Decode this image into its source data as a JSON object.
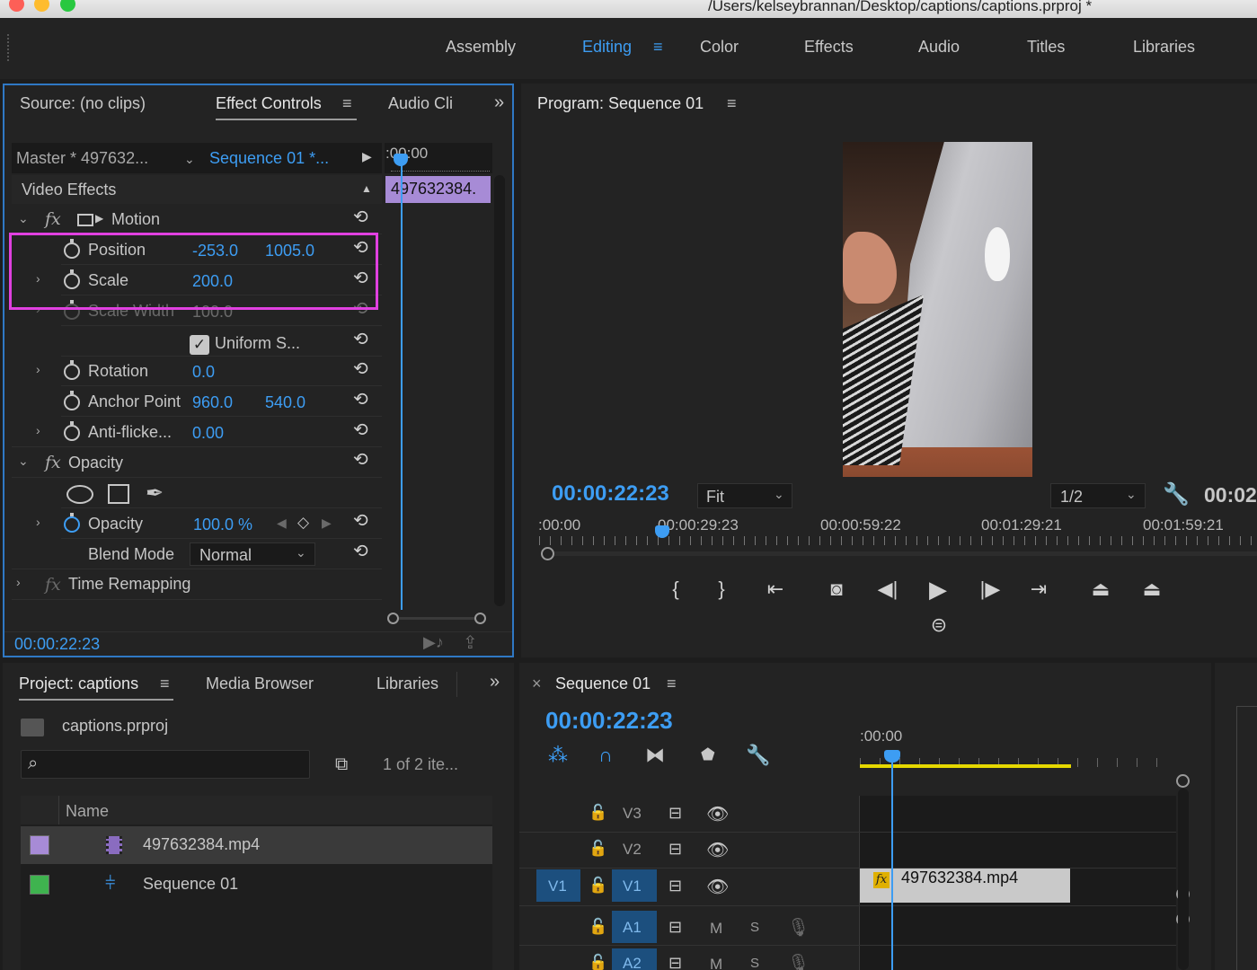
{
  "window": {
    "title": "/Users/kelseybrannan/Desktop/captions/captions.prproj *"
  },
  "workspaces": [
    "Assembly",
    "Editing",
    "Color",
    "Effects",
    "Audio",
    "Titles",
    "Libraries"
  ],
  "workspace_menu_icon": "≡",
  "source_panel": {
    "tabs": [
      "Source: (no clips)",
      "Effect Controls",
      "Audio Cli"
    ],
    "overflow": "»",
    "master_label": "Master * 497632...",
    "sequence_label": "Sequence 01 *...",
    "ruler_time": ":00:00",
    "clip_label": "497632384.",
    "section": "Video Effects",
    "motion": "Motion",
    "position": {
      "label": "Position",
      "x": "-253.0",
      "y": "1005.0"
    },
    "scale": {
      "label": "Scale",
      "value": "200.0"
    },
    "scale_width": {
      "label": "Scale Width",
      "value": "100.0"
    },
    "uniform_scale": "Uniform S...",
    "rotation": {
      "label": "Rotation",
      "value": "0.0"
    },
    "anchor_point": {
      "label": "Anchor Point",
      "x": "960.0",
      "y": "540.0"
    },
    "anti_flicker": {
      "label": "Anti-flicke...",
      "value": "0.00"
    },
    "opacity_section": "Opacity",
    "opacity": {
      "label": "Opacity",
      "value": "100.0 %"
    },
    "blend_mode": {
      "label": "Blend Mode",
      "value": "Normal"
    },
    "time_remapping": "Time Remapping",
    "timecode": "00:00:22:23"
  },
  "program": {
    "title": "Program: Sequence 01",
    "timecode": "00:00:22:23",
    "fit": "Fit",
    "resolution": "1/2",
    "duration_partial": "00:02",
    "ruler": [
      ":00:00",
      "00:00:29:23",
      "00:00:59:22",
      "00:01:29:21",
      "00:01:59:21"
    ]
  },
  "project": {
    "tabs": [
      "Project: captions",
      "Media Browser",
      "Libraries"
    ],
    "overflow": "»",
    "file": "captions.prproj",
    "count": "1 of 2 ite...",
    "column": "Name",
    "items": [
      {
        "name": "497632384.mp4",
        "color": "#a78bd6"
      },
      {
        "name": "Sequence 01",
        "color": "#3fb34f"
      }
    ]
  },
  "timeline": {
    "close": "×",
    "title": "Sequence 01",
    "timecode": "00:00:22:23",
    "ruler_time": ":00:00",
    "tracks": [
      "V3",
      "V2",
      "V1",
      "A1",
      "A2"
    ],
    "source_patch": "V1",
    "mute": "M",
    "solo": "S",
    "clip_label": "497632384.mp4",
    "fx_badge": "fx"
  },
  "colors": {
    "accent": "#3d9df3",
    "highlight": "#e040e0",
    "clip_purple": "#a78bd6",
    "work_area": "#e5d800"
  }
}
